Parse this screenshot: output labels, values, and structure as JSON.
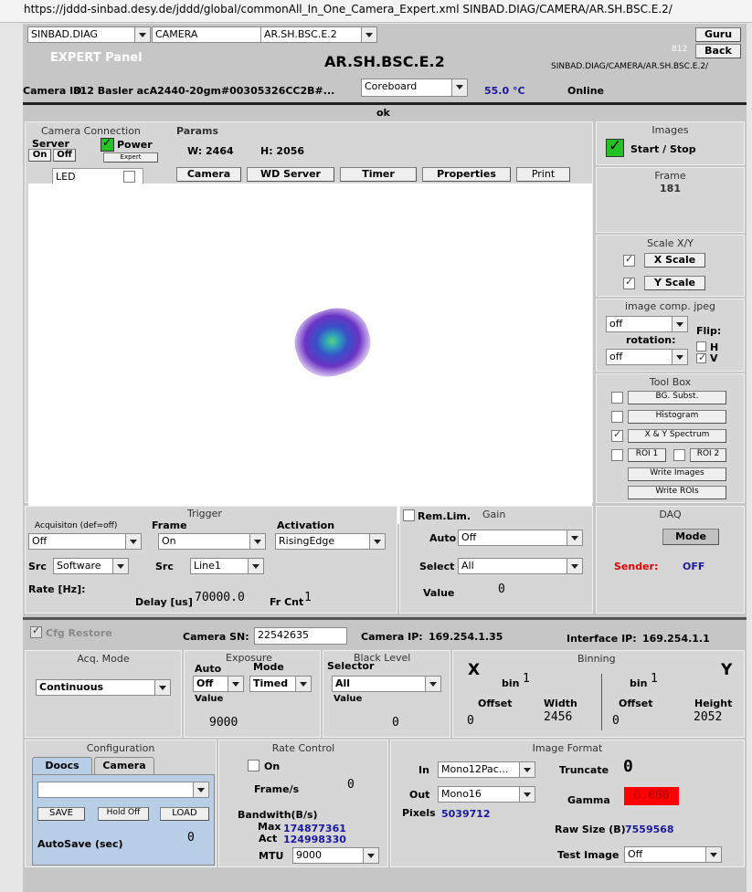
{
  "url": "https://jddd-sinbad.desy.de/jddd/global/commonAll_In_One_Camera_Expert.xml   SINBAD.DIAG/CAMERA/AR.SH.BSC.E.2/",
  "top": {
    "facility": "SINBAD.DIAG",
    "device": "CAMERA",
    "location": "AR.SH.BSC.E.2",
    "guru": "Guru",
    "back": "Back",
    "expert_panel": "EXPERT Panel",
    "title": "AR.SH.BSC.E.2",
    "small_id": "812",
    "address": "SINBAD.DIAG/CAMERA/AR.SH.BSC.E.2/",
    "camera_id_label": "Camera ID:",
    "camera_id": "812  Basler acA2440-20gm#00305326CC2B#...",
    "board": "Coreboard",
    "temp": "55.0  °C",
    "online": "Online",
    "status": "ok"
  },
  "conn": {
    "title": "Camera Connection",
    "server": "Server",
    "on": "On",
    "off": "Off",
    "power": "Power",
    "expert": "Expert",
    "led": "LED"
  },
  "params": {
    "title": "Params",
    "w": "W: 2464",
    "h": "H: 2056"
  },
  "tabs": [
    "Camera",
    "WD Server",
    "Timer",
    "Properties",
    "Print"
  ],
  "right": {
    "images": "Images",
    "start_stop": "Start / Stop",
    "frame": "Frame",
    "frame_val": "181",
    "scale_xy": "Scale X/Y",
    "xscale": "X Scale",
    "yscale": "Y Scale",
    "img_comp": "image comp. jpeg",
    "comp_val": "off",
    "flip": "Flip:",
    "rotation": "rotation:",
    "rot_val": "off",
    "h": "H",
    "v": "V",
    "toolbox": "Tool Box",
    "bg": "BG. Subst.",
    "hist": "Histogram",
    "xy": "X & Y Spectrum",
    "roi1": "ROI 1",
    "roi2": "ROI 2",
    "write_images": "Write Images",
    "write_rois": "Write ROIs"
  },
  "trigger": {
    "title": "Trigger",
    "acq": "Acquisiton (def=off)",
    "acq_val": "Off",
    "frame": "Frame",
    "frame_val": "On",
    "activation": "Activation",
    "activation_val": "RisingEdge",
    "src": "Src",
    "src_val": "Software",
    "src2_val": "Line1",
    "rate": "Rate [Hz]:",
    "delay": "Delay [us]",
    "delay_val": "70000.0",
    "frcnt": "Fr Cnt",
    "frcnt_val": "1"
  },
  "gain": {
    "remlim": "Rem.Lim.",
    "title": "Gain",
    "auto": "Auto",
    "auto_val": "Off",
    "select": "Select",
    "select_val": "All",
    "value": "Value",
    "value_val": "0"
  },
  "daq": {
    "title": "DAQ",
    "mode": "Mode",
    "sender": "Sender:",
    "sender_val": "OFF"
  },
  "info": {
    "cfg_restore": "Cfg Restore",
    "sn_label": "Camera SN:",
    "sn": "22542635",
    "ip_label": "Camera IP:",
    "ip": "169.254.1.35",
    "if_label": "Interface IP:",
    "if_ip": "169.254.1.1"
  },
  "acq": {
    "title": "Acq. Mode",
    "val": "Continuous"
  },
  "exposure": {
    "title": "Exposure",
    "auto": "Auto",
    "mode": "Mode",
    "auto_val": "Off",
    "mode_val": "Timed",
    "value": "Value",
    "value_val": "9000"
  },
  "black": {
    "title": "Black Level",
    "selector": "Selector",
    "sel_val": "All",
    "value": "Value",
    "value_val": "0"
  },
  "binning": {
    "title": "Binning",
    "x": "X",
    "y": "Y",
    "bin": "bin",
    "bin_x": "1",
    "bin_y": "1",
    "offset": "Offset",
    "width": "Width",
    "height": "Height",
    "offx": "0",
    "width_val": "2456",
    "offy": "0",
    "height_val": "2052"
  },
  "config": {
    "title": "Configuration",
    "tab1": "Doocs",
    "tab2": "Camera",
    "save": "SAVE",
    "hold": "Hold Off",
    "load": "LOAD",
    "autosave": "AutoSave (sec)",
    "autosave_val": "0"
  },
  "rate": {
    "title": "Rate Control",
    "on": "On",
    "frames": "Frame/s",
    "frames_val": "0",
    "bw": "Bandwith(B/s)",
    "max": "Max",
    "max_val": "174877361",
    "act": "Act",
    "act_val": "124998330",
    "mtu": "MTU",
    "mtu_val": "9000"
  },
  "imgfmt": {
    "title": "Image Format",
    "in": "In",
    "in_val": "Mono12Pac...",
    "out": "Out",
    "out_val": "Mono16",
    "pixels": "Pixels",
    "pixels_val": "5039712",
    "truncate": "Truncate",
    "trunc_val": "0",
    "gamma": "Gamma",
    "gamma_val": "0.000",
    "rawsize": "Raw Size (B)",
    "rawsize_val": "7559568",
    "test": "Test Image",
    "test_val": "Off"
  }
}
